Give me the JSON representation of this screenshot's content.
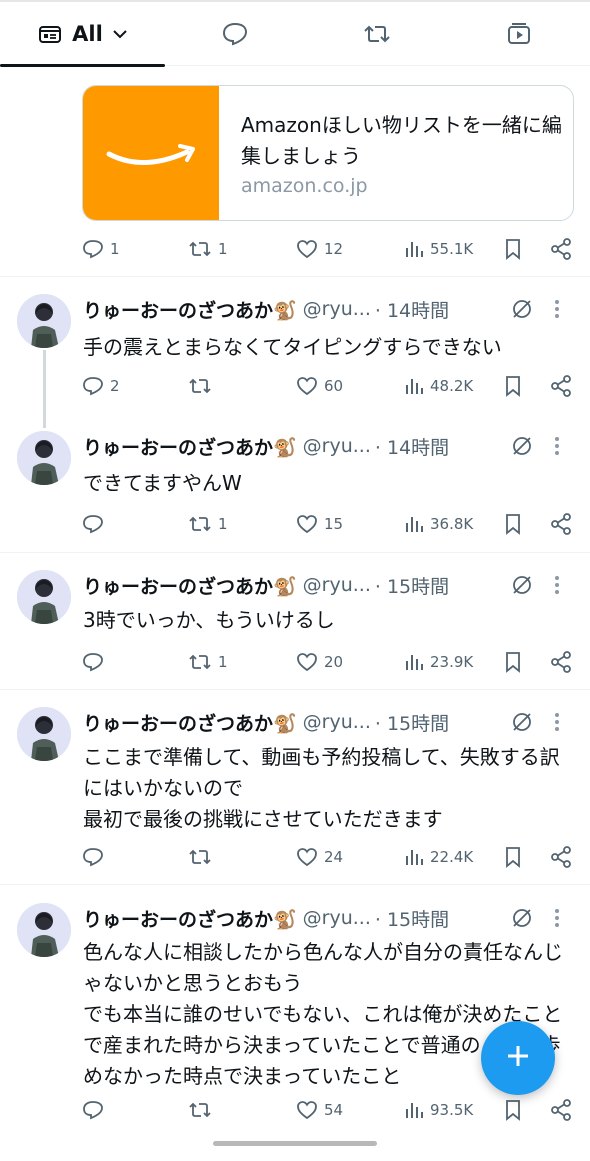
{
  "tabs": {
    "all_label": "All"
  },
  "link_card": {
    "title": "Amazonほしい物リストを一緒に編集しましょう",
    "domain": "amazon.co.jp",
    "brand_color": "#ff9900"
  },
  "first_actions": {
    "replies": "1",
    "reposts": "1",
    "likes": "12",
    "views": "55.1K"
  },
  "tweets": [
    {
      "name": "りゅーおーのざつあか🐒",
      "handle": "@ryu...",
      "time": "· 14時間",
      "text": "手の震えとまらなくてタイピングすらできない",
      "replies": "2",
      "reposts": "",
      "likes": "60",
      "views": "48.2K"
    },
    {
      "name": "りゅーおーのざつあか🐒",
      "handle": "@ryu...",
      "time": "· 14時間",
      "text": "できてますやんW",
      "replies": "",
      "reposts": "1",
      "likes": "15",
      "views": "36.8K"
    },
    {
      "name": "りゅーおーのざつあか🐒",
      "handle": "@ryu...",
      "time": "· 15時間",
      "text": "3時でいっか、もういけるし",
      "replies": "",
      "reposts": "1",
      "likes": "20",
      "views": "23.9K"
    },
    {
      "name": "りゅーおーのざつあか🐒",
      "handle": "@ryu...",
      "time": "· 15時間",
      "text": "ここまで準備して、動画も予約投稿して、失敗する訳にはいかないので\n最初で最後の挑戦にさせていただきます",
      "replies": "",
      "reposts": "",
      "likes": "24",
      "views": "22.4K"
    },
    {
      "name": "りゅーおーのざつあか🐒",
      "handle": "@ryu...",
      "time": "· 15時間",
      "text": "色んな人に相談したから色んな人が自分の責任なんじゃないかと思うとおもう\nでも本当に誰のせいでもない、これは俺が決めたことで産まれた時から決まっていたことで普通の人生を歩めなかった時点で決まっていたこと",
      "replies": "",
      "reposts": "",
      "likes": "54",
      "views": "93.5K"
    }
  ],
  "colors": {
    "accent": "#1d9bf0",
    "text": "#0f1419",
    "muted": "#536471"
  }
}
